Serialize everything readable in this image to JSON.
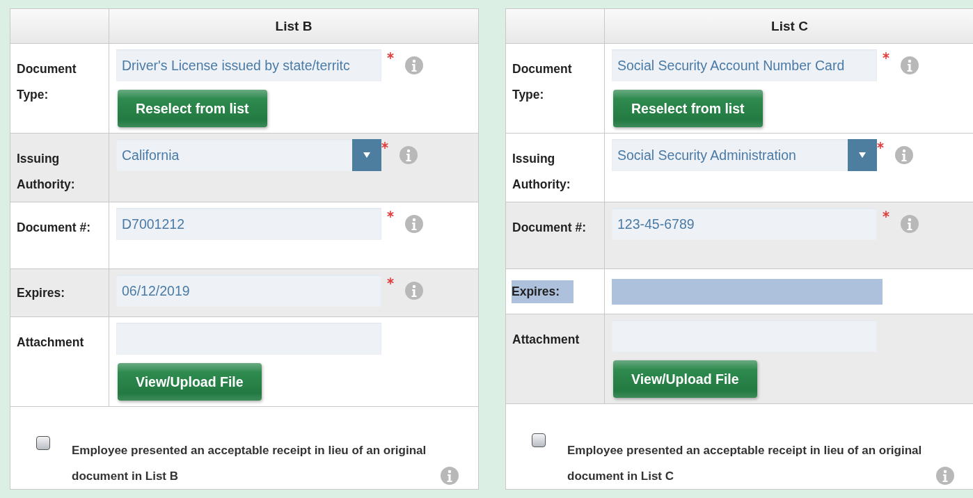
{
  "panels": [
    {
      "heading": "List B",
      "rows": [
        {
          "kind": "text",
          "label": "Document Type:",
          "value": "Driver's License issued by state/territc",
          "required": true,
          "shaded": false,
          "button": "Reselect from list"
        },
        {
          "kind": "select",
          "label": "Issuing Authority:",
          "value": "California",
          "required": true,
          "shaded": true
        },
        {
          "kind": "text",
          "label": "Document #:",
          "value": "D7001212",
          "required": true,
          "shaded": false
        },
        {
          "kind": "text",
          "label": "Expires:",
          "value": "06/12/2019",
          "required": true,
          "shaded": true
        },
        {
          "kind": "attachment",
          "label": "Attachment",
          "value": "",
          "required": false,
          "shaded": false,
          "button": "View/Upload File"
        }
      ],
      "receipt": {
        "label": "Employee presented an acceptable receipt in lieu of an original document in List B",
        "checked": false
      }
    },
    {
      "heading": "List C",
      "rows": [
        {
          "kind": "text",
          "label": "Document Type:",
          "value": "Social Security Account Number Card",
          "required": true,
          "shaded": false,
          "button": "Reselect from list"
        },
        {
          "kind": "select",
          "label": "Issuing Authority:",
          "value": "Social Security Administration",
          "required": true,
          "shaded": false
        },
        {
          "kind": "text",
          "label": "Document #:",
          "value": "123-45-6789",
          "required": true,
          "shaded": true
        },
        {
          "kind": "selection",
          "label": "Expires:",
          "shaded": false
        },
        {
          "kind": "attachment",
          "label": "Attachment",
          "value": "",
          "required": false,
          "shaded": true,
          "button": "View/Upload File"
        }
      ],
      "receipt": {
        "label": "Employee presented an acceptable receipt in lieu of an original document in List C",
        "checked": false
      }
    }
  ]
}
